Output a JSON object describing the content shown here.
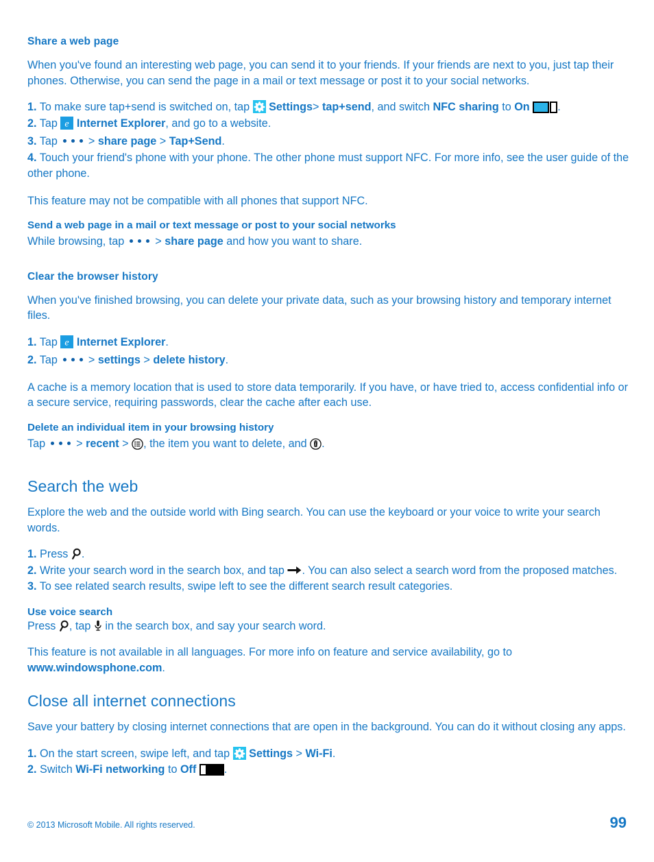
{
  "page": {
    "number": "99",
    "copyright": "© 2013 Microsoft Mobile. All rights reserved."
  },
  "sections": {
    "share_web_page": {
      "title": "Share a web page",
      "intro": "When you've found an interesting web page, you can send it to your friends. If your friends are next to you, just tap their phones. Otherwise, you can send the page in a mail or text message or post it to your social networks.",
      "steps": [
        {
          "num": "1.",
          "pre": "To make sure tap+send is switched on, tap",
          "icon": "settings-gear-tile-icon",
          "app": "Settings",
          "sep1": ">",
          "target1": "tap+send",
          "mid": ", and switch",
          "target2": "NFC sharing",
          "to_word": "to",
          "state": "On",
          "toggle": "toggle-on-icon",
          "end": "."
        },
        {
          "num": "2.",
          "pre": "Tap",
          "icon": "internet-explorer-tile-icon",
          "app": "Internet Explorer",
          "post": ", and go to a website."
        },
        {
          "num": "3.",
          "pre": "Tap",
          "icon": "more-dots-icon",
          "sep1": ">",
          "target1": "share page",
          "sep2": ">",
          "target2": "Tap+Send",
          "end": "."
        },
        {
          "num": "4.",
          "text": "Touch your friend's phone with your phone. The other phone must support NFC. For more info, see the user guide of the other phone."
        }
      ],
      "note": "This feature may not be compatible with all phones that support NFC.",
      "subsection": {
        "title": "Send a web page in a mail or text message or post to your social networks",
        "pre": "While browsing, tap",
        "icon": "more-dots-icon",
        "sep": ">",
        "target": "share page",
        "post": "and how you want to share."
      }
    },
    "clear_browser_history": {
      "title": "Clear the browser history",
      "intro": "When you've finished browsing, you can delete your private data, such as your browsing history and temporary internet files.",
      "steps": [
        {
          "num": "1.",
          "pre": "Tap",
          "icon": "internet-explorer-tile-icon",
          "app": "Internet Explorer",
          "end": "."
        },
        {
          "num": "2.",
          "pre": "Tap",
          "icon": "more-dots-icon",
          "sep1": ">",
          "target1": "settings",
          "sep2": ">",
          "target2": "delete history",
          "end": "."
        }
      ],
      "note": "A cache is a memory location that is used to store data temporarily. If you have, or have tried to, access confidential info or a secure service, requiring passwords, clear the cache after each use.",
      "subsection": {
        "title": "Delete an individual item in your browsing history",
        "pre": "Tap",
        "icon1": "more-dots-icon",
        "sep1": ">",
        "target": "recent",
        "sep2": ">",
        "icon2": "recent-list-circle-icon",
        "mid": ", the item you want to delete, and",
        "icon3": "delete-trash-circle-icon",
        "end": "."
      }
    },
    "search_the_web": {
      "title": "Search the web",
      "intro": "Explore the web and the outside world with Bing search. You can use the keyboard or your voice to write your search words.",
      "steps": [
        {
          "num": "1.",
          "pre": "Press",
          "icon": "search-magnifier-icon",
          "end": "."
        },
        {
          "num": "2.",
          "pre": "Write your search word in the search box, and tap",
          "icon": "arrow-right-icon",
          "post": ". You can also select a search word from the proposed matches."
        },
        {
          "num": "3.",
          "text": "To see related search results, swipe left to see the different search result categories."
        }
      ],
      "subsection": {
        "title": "Use voice search",
        "pre": "Press",
        "icon1": "search-magnifier-icon",
        "mid": ", tap",
        "icon2": "microphone-icon",
        "post": "in the search box, and say your search word."
      },
      "note_pre": "This feature is not available in all languages. For more info on feature and service availability, go to",
      "note_link": "www.windowsphone.com",
      "note_end": "."
    },
    "close_all_internet_connections": {
      "title": "Close all internet connections",
      "intro": "Save your battery by closing internet connections that are open in the background. You can do it without closing any apps.",
      "steps": [
        {
          "num": "1.",
          "pre": "On the start screen, swipe left, and tap",
          "icon": "settings-gear-tile-icon",
          "app": "Settings",
          "sep1": ">",
          "target1": "Wi-Fi",
          "end": "."
        },
        {
          "num": "2.",
          "pre": "Switch",
          "target1": "Wi-Fi networking",
          "to_word": "to",
          "state": "Off",
          "toggle": "toggle-off-icon",
          "end": "."
        }
      ]
    }
  },
  "colors": {
    "text_blue": "#1577c4",
    "gear_tile": "#25c3ef",
    "ie_tile": "#1b9de2",
    "toggle_on_fill": "#2bb3e8"
  }
}
